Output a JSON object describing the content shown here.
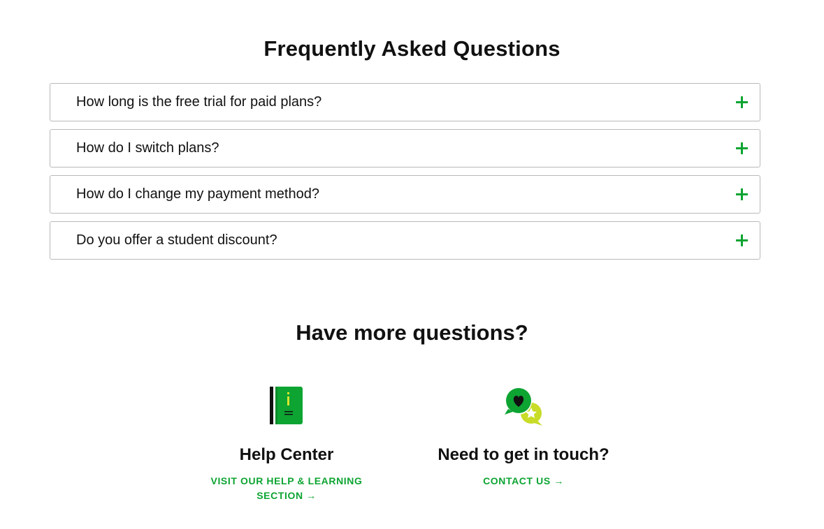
{
  "faq": {
    "title": "Frequently Asked Questions",
    "items": [
      {
        "question": "How long is the free trial for paid plans?"
      },
      {
        "question": "How do I switch plans?"
      },
      {
        "question": "How do I change my payment method?"
      },
      {
        "question": "Do you offer a student discount?"
      }
    ],
    "expand_icon": "plus-icon"
  },
  "more": {
    "title": "Have more questions?",
    "help_center": {
      "icon": "info-book-icon",
      "title": "Help Center",
      "link": "VISIT OUR HELP & LEARNING SECTION →"
    },
    "contact": {
      "icon": "chat-bubbles-icon",
      "title": "Need to get in touch?",
      "link": "CONTACT US →"
    }
  },
  "colors": {
    "accent": "#0da432",
    "accent_light": "#c8dc28",
    "text": "#111111",
    "border": "#b9b9b9"
  }
}
